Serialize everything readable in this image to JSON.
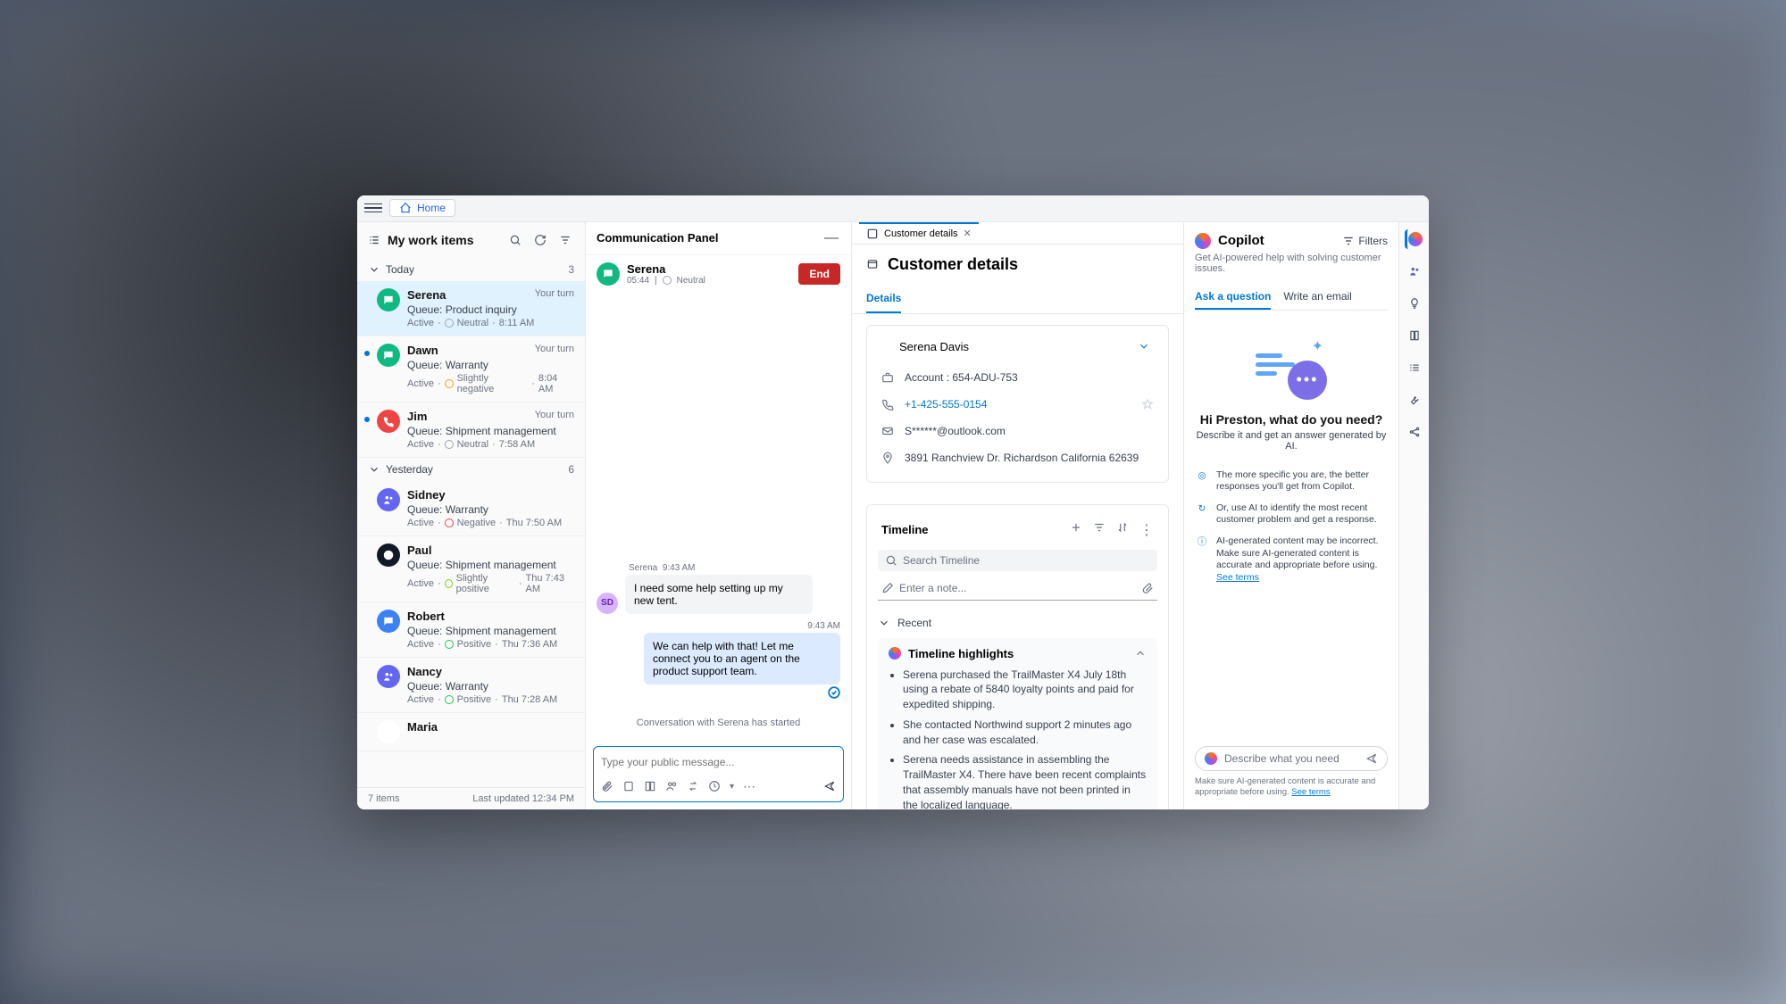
{
  "topbar": {
    "home": "Home"
  },
  "left": {
    "title": "My work items",
    "footer_count": "7 items",
    "footer_updated": "Last updated 12:34 PM",
    "groups": [
      {
        "label": "Today",
        "count": "3"
      },
      {
        "label": "Yesterday",
        "count": "6"
      }
    ],
    "items": [
      {
        "name": "Serena",
        "turn": "Your turn",
        "queue": "Queue: Product inquiry",
        "status": "Active",
        "sentiment": "Neutral",
        "senti_color": "#9ca3af",
        "time": "8:11 AM",
        "avatar_bg": "#10b981",
        "selected": true,
        "unread": false,
        "icon": "chat"
      },
      {
        "name": "Dawn",
        "turn": "Your turn",
        "queue": "Queue: Warranty",
        "status": "Active",
        "sentiment": "Slightly negative",
        "senti_color": "#f59e0b",
        "time": "8:04 AM",
        "avatar_bg": "#10b981",
        "selected": false,
        "unread": true,
        "icon": "chat"
      },
      {
        "name": "Jim",
        "turn": "Your turn",
        "queue": "Queue: Shipment management",
        "status": "Active",
        "sentiment": "Neutral",
        "senti_color": "#9ca3af",
        "time": "7:58 AM",
        "avatar_bg": "#ef4444",
        "selected": false,
        "unread": true,
        "icon": "phone"
      },
      {
        "name": "Sidney",
        "turn": "",
        "queue": "Queue: Warranty",
        "status": "Active",
        "sentiment": "Negative",
        "senti_color": "#ef4444",
        "time": "Thu 7:50 AM",
        "avatar_bg": "#6366f1",
        "selected": false,
        "unread": false,
        "icon": "teams"
      },
      {
        "name": "Paul",
        "turn": "",
        "queue": "Queue: Shipment management",
        "status": "Active",
        "sentiment": "Slightly positive",
        "senti_color": "#84cc16",
        "time": "Thu 7:43 AM",
        "avatar_bg": "#111827",
        "selected": false,
        "unread": false,
        "icon": "messenger"
      },
      {
        "name": "Robert",
        "turn": "",
        "queue": "Queue: Shipment management",
        "status": "Active",
        "sentiment": "Positive",
        "senti_color": "#22c55e",
        "time": "Thu 7:36 AM",
        "avatar_bg": "#3b82f6",
        "selected": false,
        "unread": false,
        "icon": "chat"
      },
      {
        "name": "Nancy",
        "turn": "",
        "queue": "Queue: Warranty",
        "status": "Active",
        "sentiment": "Positive",
        "senti_color": "#22c55e",
        "time": "Thu 7:28 AM",
        "avatar_bg": "#6366f1",
        "selected": false,
        "unread": false,
        "icon": "teams"
      },
      {
        "name": "Maria",
        "turn": "",
        "queue": "",
        "status": "",
        "sentiment": "",
        "senti_color": "",
        "time": "",
        "avatar_bg": "#fff",
        "selected": false,
        "unread": false,
        "icon": ""
      }
    ]
  },
  "center": {
    "title": "Communication Panel",
    "conv_name": "Serena",
    "conv_time": "05:44",
    "conv_sentiment": "Neutral",
    "end": "End",
    "msg_sender": "Serena",
    "msg_time_in": "9:43 AM",
    "msg_in": "I need some help setting up my new tent.",
    "msg_time_out": "9:43 AM",
    "msg_out": "We can help with that! Let me connect you to an agent on the product support team.",
    "sys": "Conversation with Serena has started",
    "placeholder": "Type your public message...",
    "avatar_initials": "SD"
  },
  "details": {
    "tab": "Customer details",
    "title": "Customer details",
    "subtab": "Details",
    "name": "Serena Davis",
    "account": "Account : 654-ADU-753",
    "phone": "+1-425-555-0154",
    "email": "S******@outlook.com",
    "address": "3891 Ranchview Dr. Richardson California 62639",
    "timeline": "Timeline",
    "search_ph": "Search Timeline",
    "note_ph": "Enter a note...",
    "recent": "Recent",
    "highlights_title": "Timeline highlights",
    "highlights": [
      "Serena purchased the TrailMaster X4 July 18th using a rebate of 5840 loyalty points and paid for expedited shipping.",
      "She contacted Northwind support 2 minutes ago and her case was escalated.",
      "Serena needs assistance in assembling the TrailMaster X4. There have been recent complaints that assembly manuals have not been printed in the localized language."
    ]
  },
  "copilot": {
    "title": "Copilot",
    "filters": "Filters",
    "sub": "Get AI-powered help with solving customer issues.",
    "tab1": "Ask a question",
    "tab2": "Write an email",
    "greet": "Hi Preston, what do you need?",
    "desc": "Describe it and get an answer generated by AI.",
    "hint1": "The more specific you are, the better responses you'll get from Copilot.",
    "hint2": "Or, use AI to identify the most recent customer problem and get a response.",
    "hint3": "AI-generated content may be incorrect. Make sure AI-generated content is accurate and appropriate before using.",
    "see_terms": "See terms",
    "input_ph": "Describe what you need",
    "disclaimer": "Make sure AI-generated content is accurate and appropriate before using."
  }
}
